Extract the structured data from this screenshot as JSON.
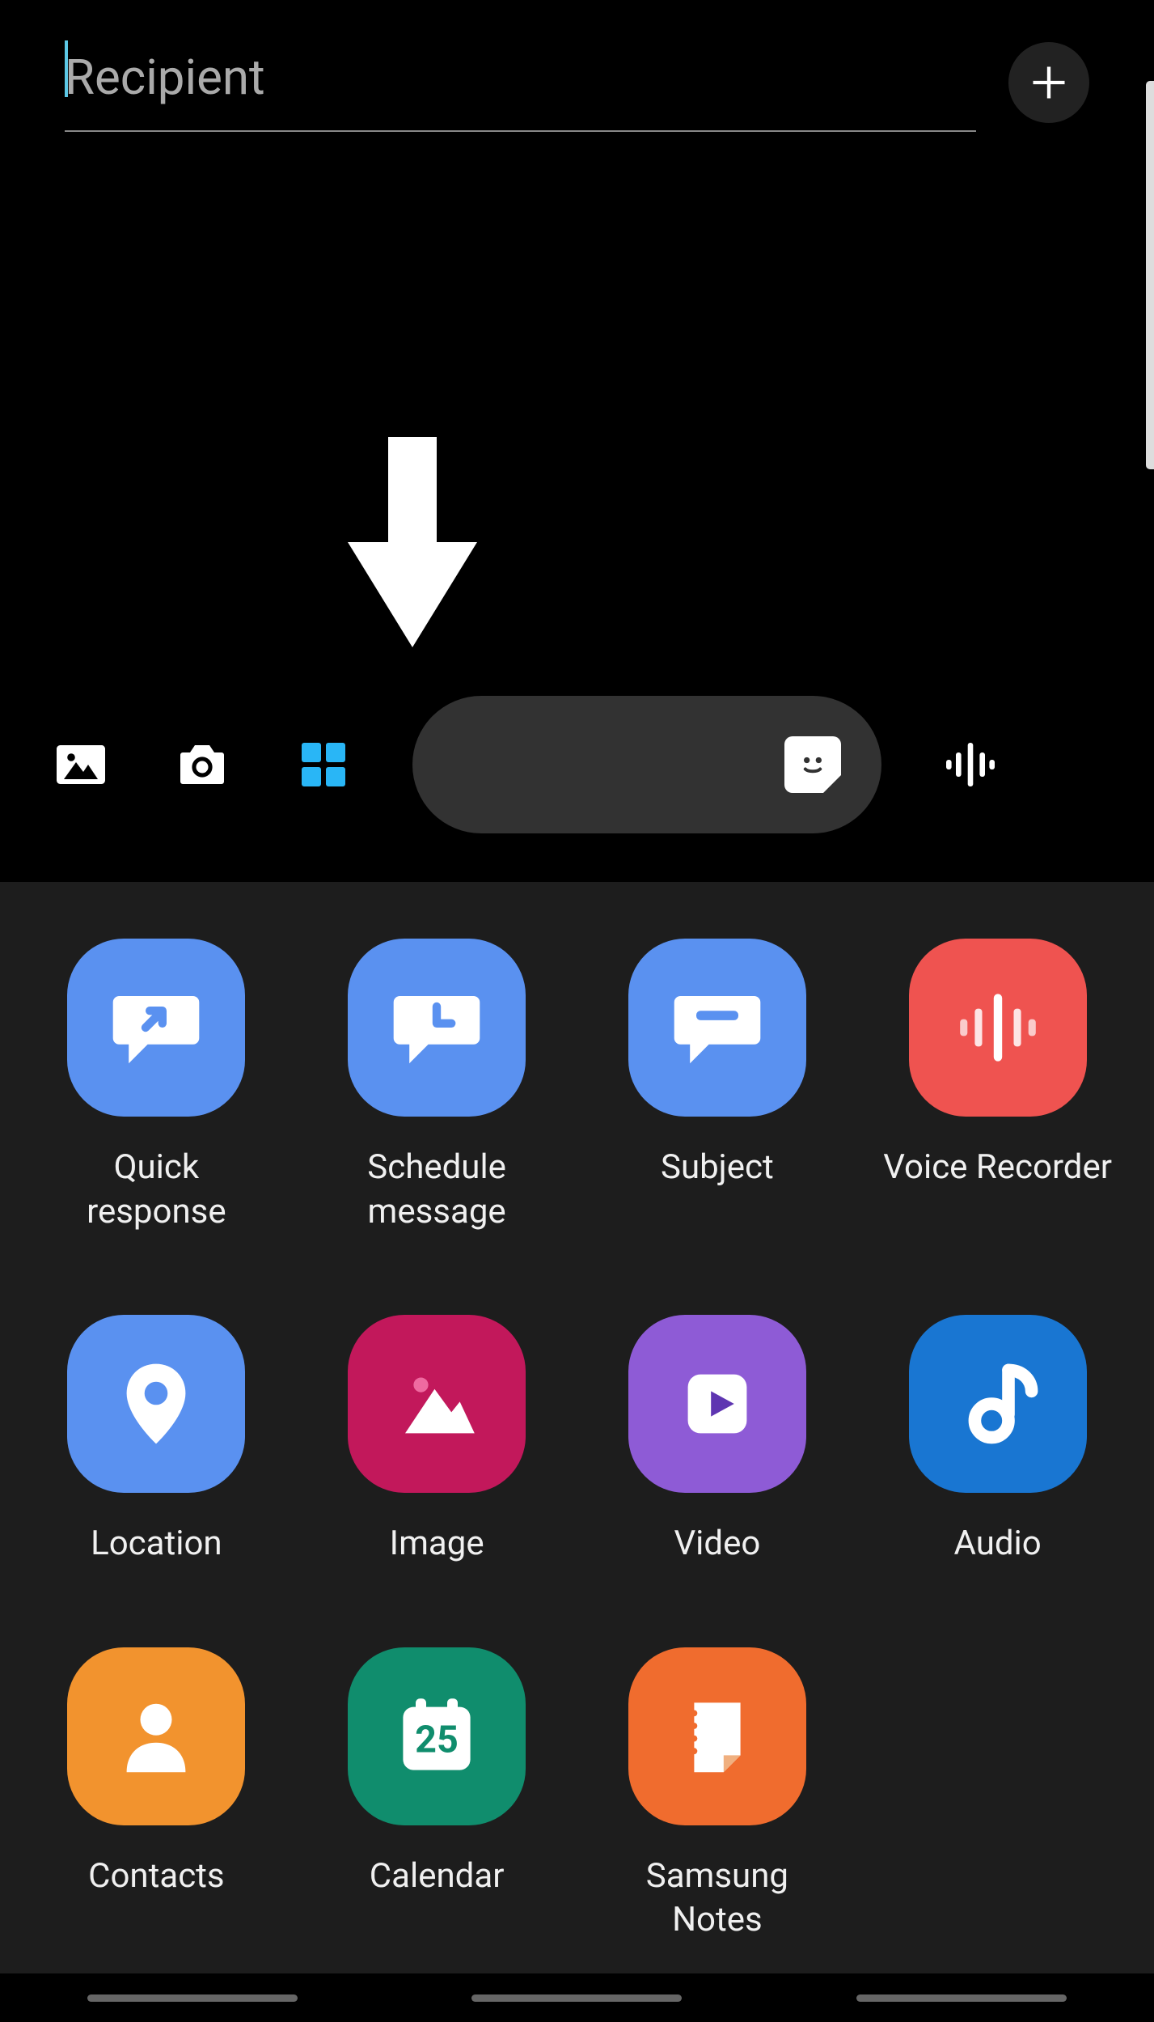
{
  "recipient": {
    "placeholder": "Recipient"
  },
  "calendar_day": "25",
  "attachments": [
    {
      "id": "quick-response",
      "label": "Quick\nresponse",
      "color": "c-blue",
      "glyph": "bubble-arrow"
    },
    {
      "id": "schedule-message",
      "label": "Schedule\nmessage",
      "color": "c-blue",
      "glyph": "bubble-clock"
    },
    {
      "id": "subject",
      "label": "Subject",
      "color": "c-blue",
      "glyph": "bubble-line"
    },
    {
      "id": "voice-recorder",
      "label": "Voice Recorder",
      "color": "c-red",
      "glyph": "wave"
    },
    {
      "id": "location",
      "label": "Location",
      "color": "c-blue",
      "glyph": "pin"
    },
    {
      "id": "image",
      "label": "Image",
      "color": "c-magenta",
      "glyph": "mountain"
    },
    {
      "id": "video",
      "label": "Video",
      "color": "c-purple",
      "glyph": "play"
    },
    {
      "id": "audio",
      "label": "Audio",
      "color": "c-dblue",
      "glyph": "note"
    },
    {
      "id": "contacts",
      "label": "Contacts",
      "color": "c-orange",
      "glyph": "person"
    },
    {
      "id": "calendar",
      "label": "Calendar",
      "color": "c-teal",
      "glyph": "cal"
    },
    {
      "id": "samsung-notes",
      "label": "Samsung\nNotes",
      "color": "c-dorange",
      "glyph": "notepage"
    }
  ]
}
